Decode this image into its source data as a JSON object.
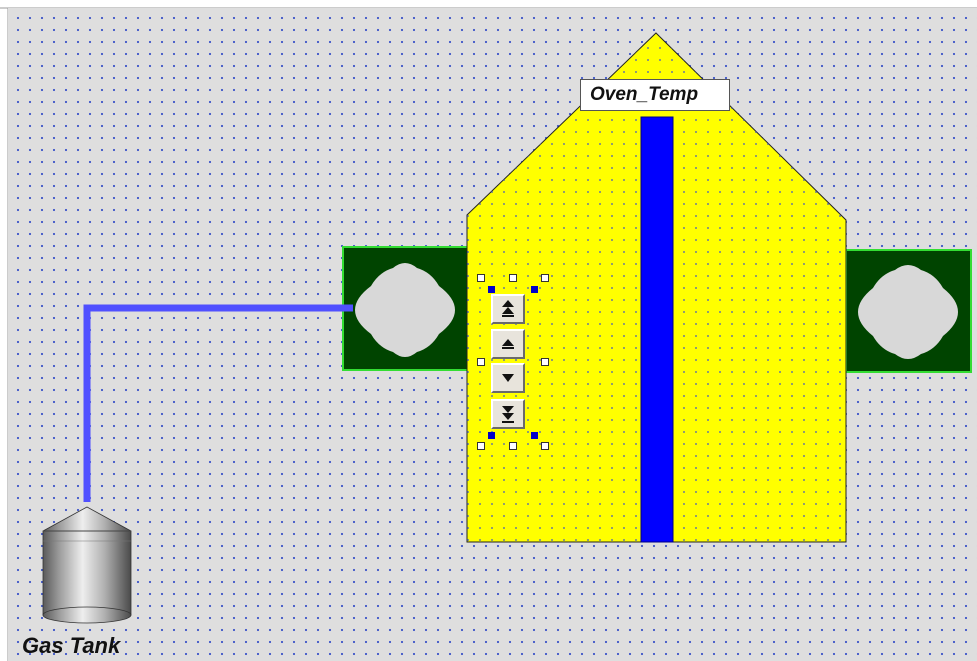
{
  "oven": {
    "label": "Oven_Temp",
    "body_color": "#ffff00",
    "bar_color": "#0000ff"
  },
  "tank": {
    "label": "Gas Tank"
  },
  "pipe": {
    "color": "#5050ff"
  },
  "burners": {
    "color": "#004400",
    "border_color": "#33dd33"
  },
  "spin_control": {
    "buttons": [
      {
        "icon": "double-up-arrow-icon"
      },
      {
        "icon": "up-arrow-icon"
      },
      {
        "icon": "down-arrow-icon"
      },
      {
        "icon": "double-down-arrow-icon"
      }
    ]
  },
  "canvas": {
    "background": "#dedede",
    "grid_dot_color": "#3d55c8"
  }
}
